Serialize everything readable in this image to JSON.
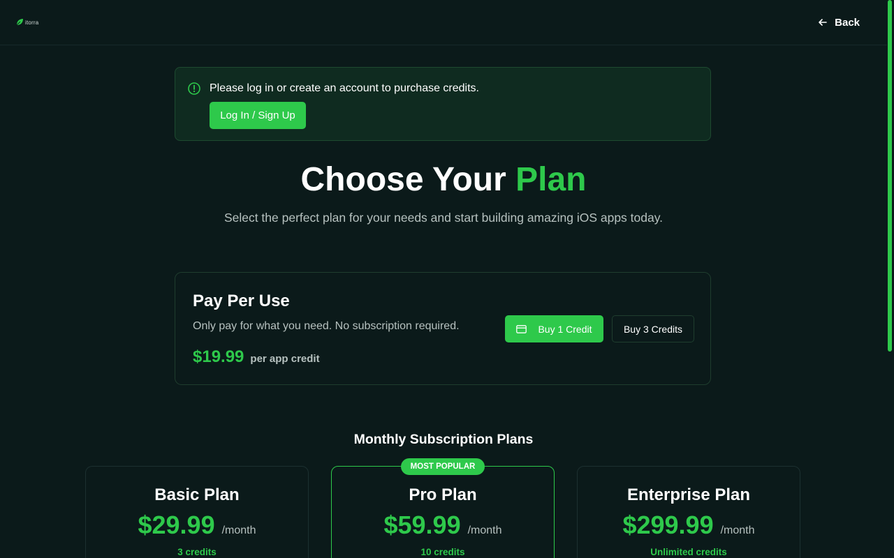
{
  "header": {
    "logo_text": "itorra",
    "back_label": "Back"
  },
  "notice": {
    "message": "Please log in or create an account to purchase credits.",
    "button_label": "Log In / Sign Up"
  },
  "hero": {
    "title_main": "Choose Your ",
    "title_accent": "Plan",
    "subtitle": "Select the perfect plan for your needs and start building amazing iOS apps today."
  },
  "pay_per_use": {
    "title": "Pay Per Use",
    "description": "Only pay for what you need. No subscription required.",
    "price": "$19.99",
    "price_unit": "per app credit",
    "buy_one_label": "Buy 1 Credit",
    "buy_three_label": "Buy 3 Credits"
  },
  "subscriptions": {
    "title": "Monthly Subscription Plans",
    "plans": [
      {
        "name": "Basic Plan",
        "price": "$29.99",
        "period": "/month",
        "credits": "3 credits"
      },
      {
        "name": "Pro Plan",
        "price": "$59.99",
        "period": "/month",
        "credits": "10 credits",
        "badge": "MOST POPULAR"
      },
      {
        "name": "Enterprise Plan",
        "price": "$299.99",
        "period": "/month",
        "credits": "Unlimited credits"
      }
    ]
  },
  "colors": {
    "background": "#0b1a1a",
    "accent": "#2ec94b",
    "muted_text": "#b6c1bf"
  },
  "icons": {
    "logo": "leaf-logo-icon",
    "back": "arrow-left-icon",
    "notice": "alert-circle-icon",
    "buy": "credit-card-icon"
  }
}
